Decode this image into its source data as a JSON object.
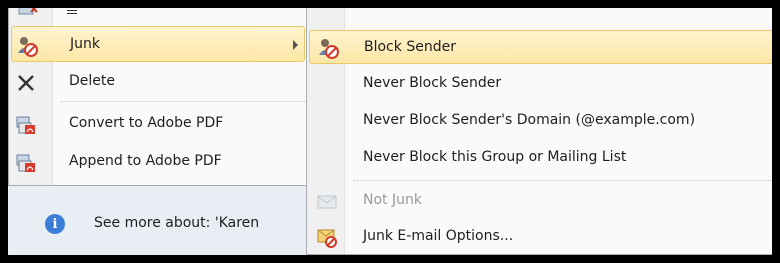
{
  "menu": {
    "items": [
      {
        "label": "Junk",
        "icon": "junk-people-icon",
        "highlighted": true,
        "has_submenu": true
      },
      {
        "label": "Delete",
        "icon": "delete-x-icon"
      },
      {
        "label": "Convert to Adobe PDF",
        "icon": "adobe-pdf-convert-icon"
      },
      {
        "label": "Append to Adobe PDF",
        "icon": "adobe-pdf-append-icon"
      }
    ]
  },
  "info_bar": {
    "text": "See more about: 'Karen",
    "icon": "info-icon",
    "icon_glyph": "i"
  },
  "submenu": {
    "items": [
      {
        "label": "Block Sender",
        "icon": "block-sender-icon",
        "highlighted": true
      },
      {
        "label": "Never Block Sender"
      },
      {
        "label": "Never Block Sender's Domain (@example.com)"
      },
      {
        "label": "Never Block this Group or Mailing List"
      },
      {
        "label": "Not Junk",
        "icon": "not-junk-envelope-icon",
        "disabled": true
      },
      {
        "label": "Junk E-mail Options...",
        "icon": "junk-options-icon"
      }
    ]
  },
  "colors": {
    "highlight": "#fde7a7",
    "highlight_border": "#e9c86c",
    "info_blue": "#3c7ed6",
    "disabled_text": "#9a9a9a"
  }
}
